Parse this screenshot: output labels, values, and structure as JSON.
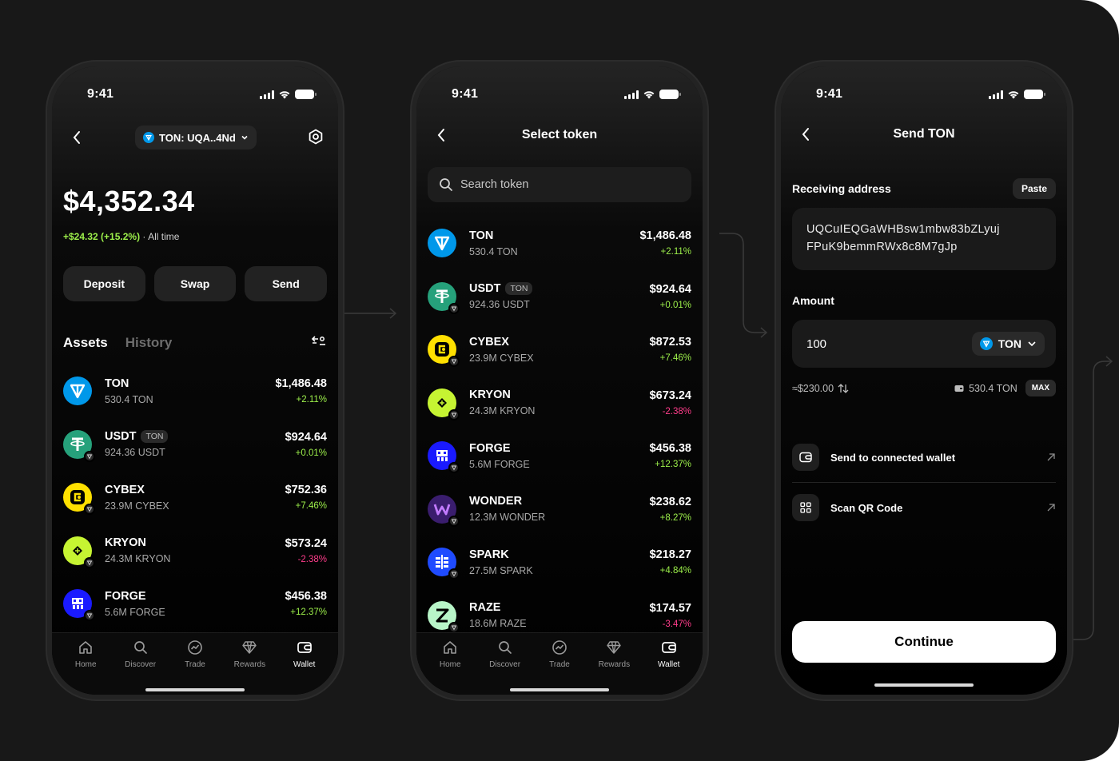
{
  "colors": {
    "background": "#181818",
    "positive": "#9df04b",
    "negative": "#ff3d8b",
    "ton_blue": "#0098ea"
  },
  "status": {
    "time": "9:41"
  },
  "wallet": {
    "pill": "TON: UQA..4Nd",
    "balance": "$4,352.34",
    "change": "+$24.32 (+15.2%)",
    "change_suffix": " · All time",
    "actions": [
      "Deposit",
      "Swap",
      "Send"
    ],
    "tabs": {
      "assets": "Assets",
      "history": "History"
    },
    "tokens": [
      {
        "name": "TON",
        "badge": "",
        "amount": "530.4 TON",
        "usd": "$1,486.48",
        "change": "+2.11%",
        "trend": "pos",
        "icon": "ton-icon"
      },
      {
        "name": "USDT",
        "badge": "TON",
        "amount": "924.36 USDT",
        "usd": "$924.64",
        "change": "+0.01%",
        "trend": "pos",
        "icon": "usdt-icon"
      },
      {
        "name": "CYBEX",
        "badge": "",
        "amount": "23.9M CYBEX",
        "usd": "$752.36",
        "change": "+7.46%",
        "trend": "pos",
        "icon": "cybex-icon"
      },
      {
        "name": "KRYON",
        "badge": "",
        "amount": "24.3M KRYON",
        "usd": "$573.24",
        "change": "-2.38%",
        "trend": "neg",
        "icon": "kryon-icon"
      },
      {
        "name": "FORGE",
        "badge": "",
        "amount": "5.6M FORGE",
        "usd": "$456.38",
        "change": "+12.37%",
        "trend": "pos",
        "icon": "forge-icon"
      }
    ]
  },
  "select": {
    "title": "Select token",
    "search_placeholder": "Search token",
    "tokens": [
      {
        "name": "TON",
        "badge": "",
        "amount": "530.4 TON",
        "usd": "$1,486.48",
        "change": "+2.11%",
        "trend": "pos",
        "icon": "ton-icon"
      },
      {
        "name": "USDT",
        "badge": "TON",
        "amount": "924.36 USDT",
        "usd": "$924.64",
        "change": "+0.01%",
        "trend": "pos",
        "icon": "usdt-icon"
      },
      {
        "name": "CYBEX",
        "badge": "",
        "amount": "23.9M CYBEX",
        "usd": "$872.53",
        "change": "+7.46%",
        "trend": "pos",
        "icon": "cybex-icon"
      },
      {
        "name": "KRYON",
        "badge": "",
        "amount": "24.3M KRYON",
        "usd": "$673.24",
        "change": "-2.38%",
        "trend": "neg",
        "icon": "kryon-icon"
      },
      {
        "name": "FORGE",
        "badge": "",
        "amount": "5.6M FORGE",
        "usd": "$456.38",
        "change": "+12.37%",
        "trend": "pos",
        "icon": "forge-icon"
      },
      {
        "name": "WONDER",
        "badge": "",
        "amount": "12.3M WONDER",
        "usd": "$238.62",
        "change": "+8.27%",
        "trend": "pos",
        "icon": "wonder-icon"
      },
      {
        "name": "SPARK",
        "badge": "",
        "amount": "27.5M SPARK",
        "usd": "$218.27",
        "change": "+4.84%",
        "trend": "pos",
        "icon": "spark-icon"
      },
      {
        "name": "RAZE",
        "badge": "",
        "amount": "18.6M RAZE",
        "usd": "$174.57",
        "change": "-3.47%",
        "trend": "neg",
        "icon": "raze-icon"
      }
    ]
  },
  "send": {
    "title": "Send TON",
    "address_label": "Receiving address",
    "paste": "Paste",
    "address_line1": "UQCuIEQGaWHBsw1mbw83bZLyuj",
    "address_line2": "FPuK9bemmRWx8c8M7gJp",
    "amount_label": "Amount",
    "amount_value": "100",
    "token": "TON",
    "converted": "≈$230.00",
    "available": "530.4 TON",
    "max": "MAX",
    "option1": "Send to connected wallet",
    "option2": "Scan QR Code",
    "continue": "Continue"
  },
  "nav": [
    "Home",
    "Discover",
    "Trade",
    "Rewards",
    "Wallet"
  ]
}
